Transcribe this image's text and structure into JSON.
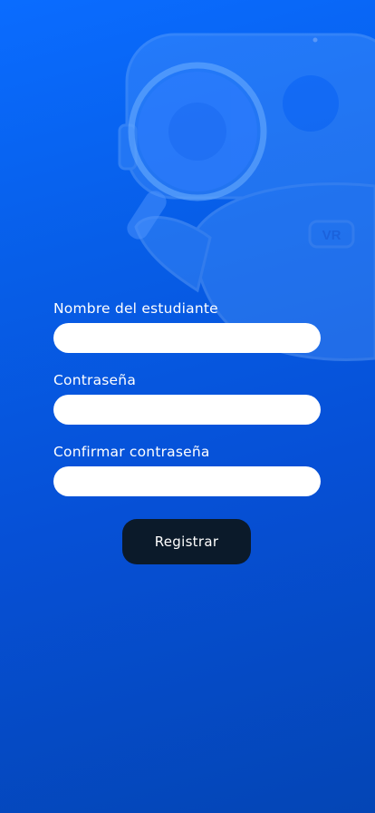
{
  "form": {
    "student_name_label": "Nombre del estudiante",
    "student_name_value": "",
    "password_label": "Contraseña",
    "password_value": "",
    "confirm_password_label": "Confirmar contraseña",
    "confirm_password_value": ""
  },
  "submit_label": "Registrar",
  "mascot": {
    "icon": "robot-mascot-illustration",
    "badge_text": "VR"
  },
  "colors": {
    "background_top": "#0a6cff",
    "background_bottom": "#0445b5",
    "button": "#0b1a2a",
    "field": "#ffffff",
    "label": "#ffffff"
  }
}
